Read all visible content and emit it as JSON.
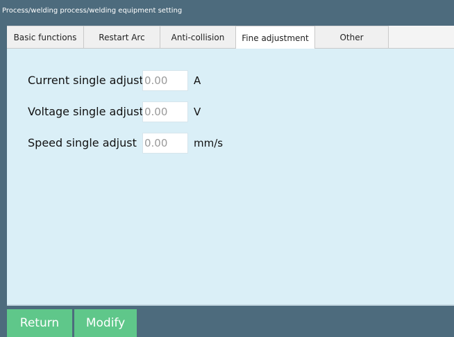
{
  "breadcrumb": "Process/welding process/welding equipment setting",
  "tabs": [
    {
      "label": "Basic functions",
      "active": false
    },
    {
      "label": "Restart Arc",
      "active": false
    },
    {
      "label": "Anti-collision",
      "active": false
    },
    {
      "label": "Fine adjustment",
      "active": true
    },
    {
      "label": "Other",
      "active": false
    }
  ],
  "fields": [
    {
      "label": "Current single adjust",
      "value": "0.00",
      "unit": "A"
    },
    {
      "label": "Voltage single adjust",
      "value": "0.00",
      "unit": "V"
    },
    {
      "label": "Speed single adjust",
      "value": "0.00",
      "unit": "mm/s"
    }
  ],
  "footer": {
    "return_label": "Return",
    "modify_label": "Modify"
  },
  "colors": {
    "header_bg": "#4d6b7d",
    "content_bg": "#daeff7",
    "button_green": "#5fc78a"
  }
}
